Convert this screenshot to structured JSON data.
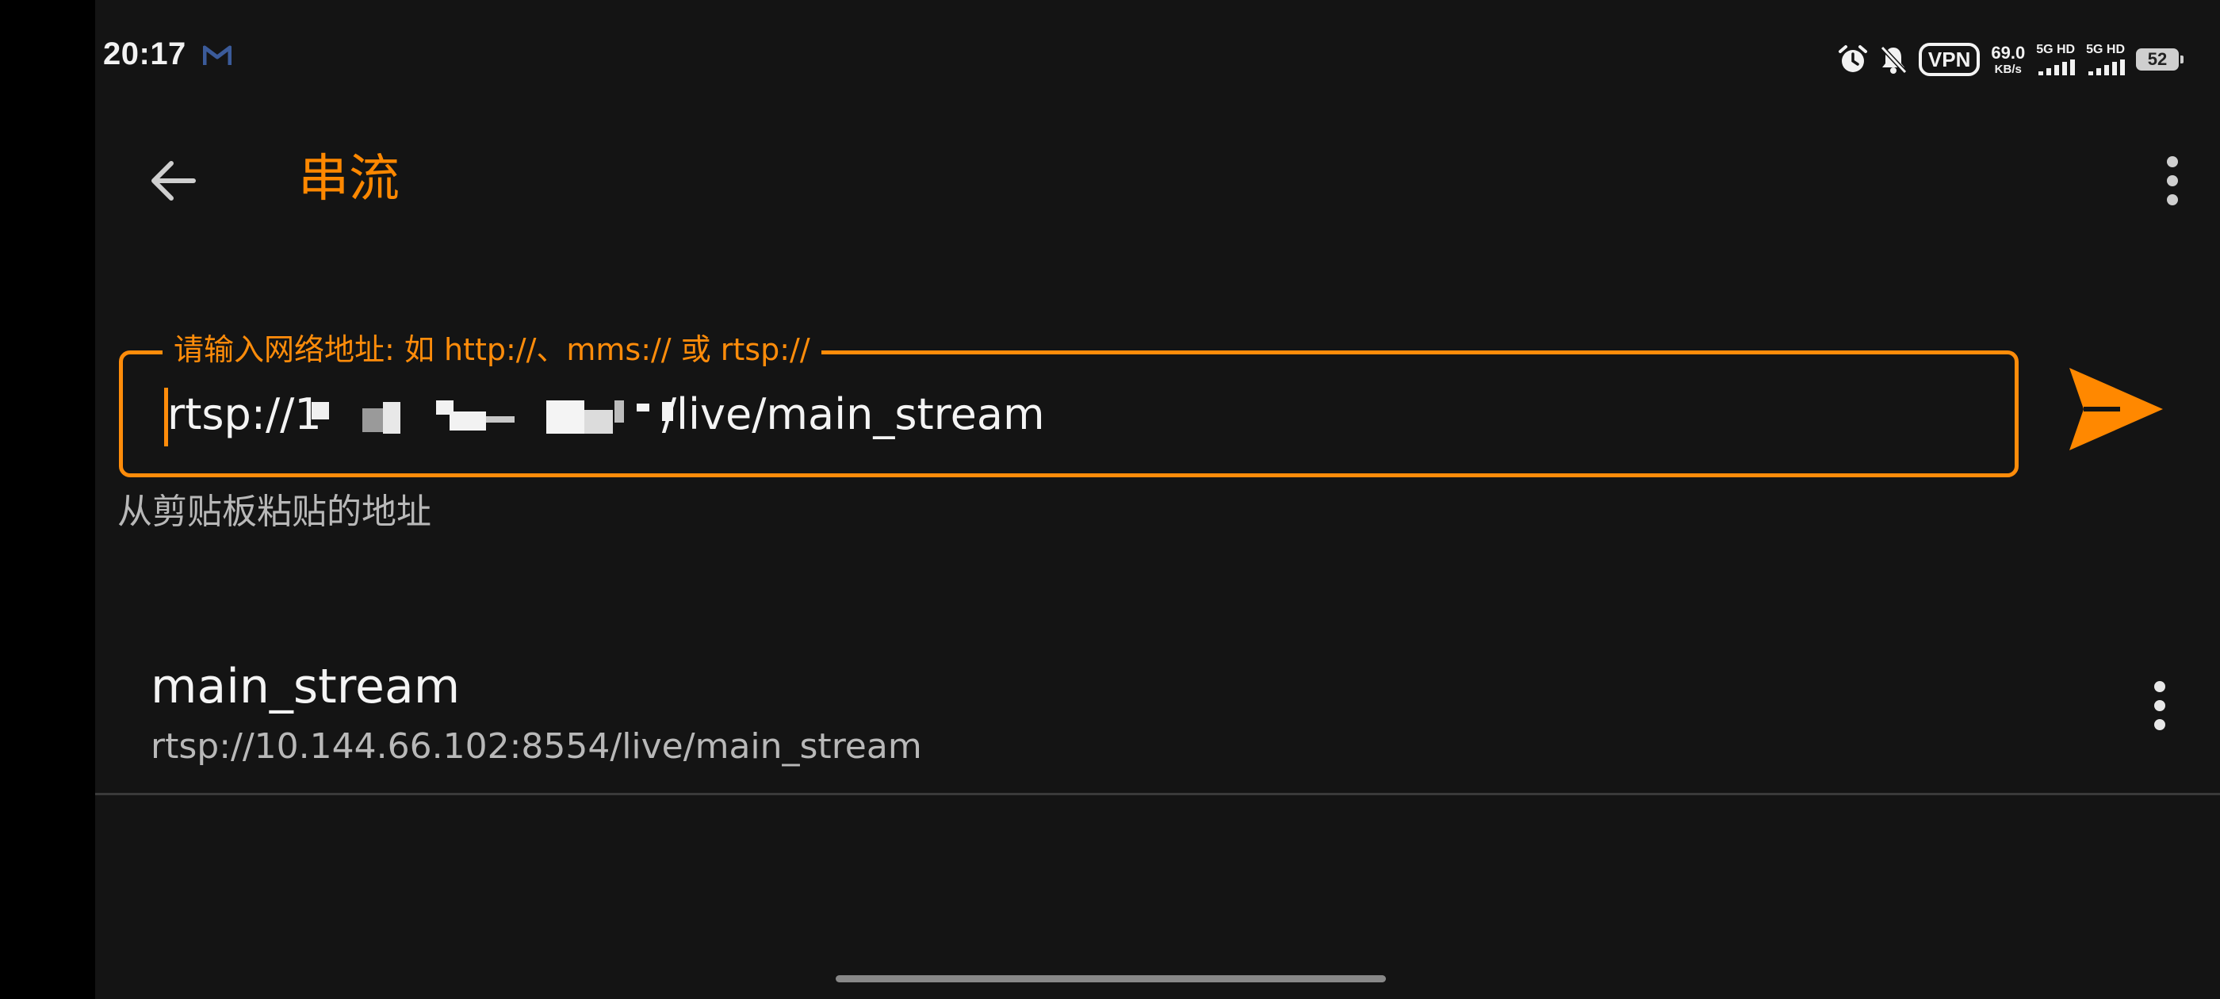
{
  "status_bar": {
    "time": "20:17",
    "notification_icon": "gmail-icon",
    "icons": [
      "alarm-icon",
      "bell-off-icon"
    ],
    "vpn": "VPN",
    "speed_value": "69.0",
    "speed_unit": "KB/s",
    "signal_1_label": "5G HD",
    "signal_2_label": "5G HD",
    "battery": "52"
  },
  "app_bar": {
    "title": "串流",
    "back_icon": "arrow-left-icon",
    "menu_icon": "more-vertical-icon"
  },
  "url_input": {
    "label": "请输入网络地址: 如 http://、mms:// 或 rtsp://",
    "value": "rtsp://1                         /live/main_stream",
    "value_prefix": "rtsp://1",
    "value_suffix": "4/live/main_stream",
    "hint": "从剪贴板粘贴的地址",
    "send_icon": "send-icon"
  },
  "history": [
    {
      "title": "main_stream",
      "url": "rtsp://10.144.66.102:8554/live/main_stream"
    }
  ],
  "colors": {
    "accent": "#ff8800",
    "background": "#141414",
    "text_primary": "#f4f4f4",
    "text_secondary": "#b8b8b8"
  }
}
